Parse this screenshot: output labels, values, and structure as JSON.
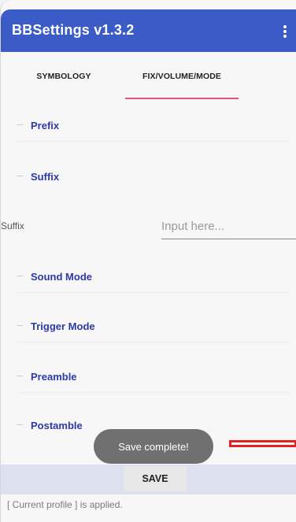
{
  "app": {
    "title": "BBSettings v1.3.2"
  },
  "tabs": [
    {
      "label": "SYMBOLOGY"
    },
    {
      "label": "FIX/VOLUME/MODE"
    }
  ],
  "list_items": [
    {
      "label": "Prefix"
    },
    {
      "label": "Suffix"
    },
    {
      "label": "Sound Mode"
    },
    {
      "label": "Trigger Mode"
    },
    {
      "label": "Preamble"
    },
    {
      "label": "Postamble"
    }
  ],
  "suffix_field": {
    "label": "Suffix",
    "placeholder": "Input here..."
  },
  "toast": {
    "text": "Save complete!"
  },
  "save_button": {
    "label": "SAVE"
  },
  "status": {
    "text": "[ Current profile ] is applied."
  },
  "colors": {
    "appbar": "#3b5cc7",
    "tab_indicator": "#e0567a",
    "annotation": "#e02424"
  }
}
